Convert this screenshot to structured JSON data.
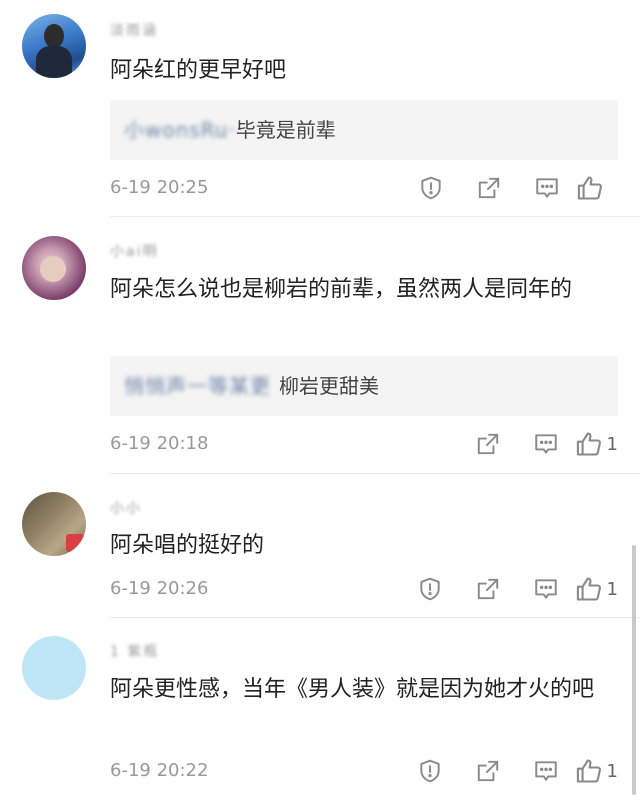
{
  "comments": [
    {
      "username": "淡雨涵",
      "text": "阿朵红的更早好吧",
      "quote_name": "小wonsRu·",
      "quote_text": "毕竟是前辈",
      "time": "6-19 20:25",
      "likes": "",
      "avatar_color": "#3a78c9"
    },
    {
      "username": "小ai明",
      "text": "阿朵怎么说也是柳岩的前辈，虽然两人是同年的",
      "quote_name": "悄悄声一等某更",
      "quote_text": "柳岩更甜美",
      "time": "6-19 20:18",
      "likes": "1",
      "avatar_color": "#a05e86"
    },
    {
      "username": "小小",
      "text": "阿朵唱的挺好的",
      "time": "6-19 20:26",
      "likes": "1",
      "avatar_color": "#7d6d57"
    },
    {
      "username": "1 紫瓶",
      "text": "阿朵更性感，当年《男人装》就是因为她才火的吧",
      "time": "6-19 20:22",
      "likes": "1",
      "avatar_color": "#bfe6f7"
    }
  ]
}
